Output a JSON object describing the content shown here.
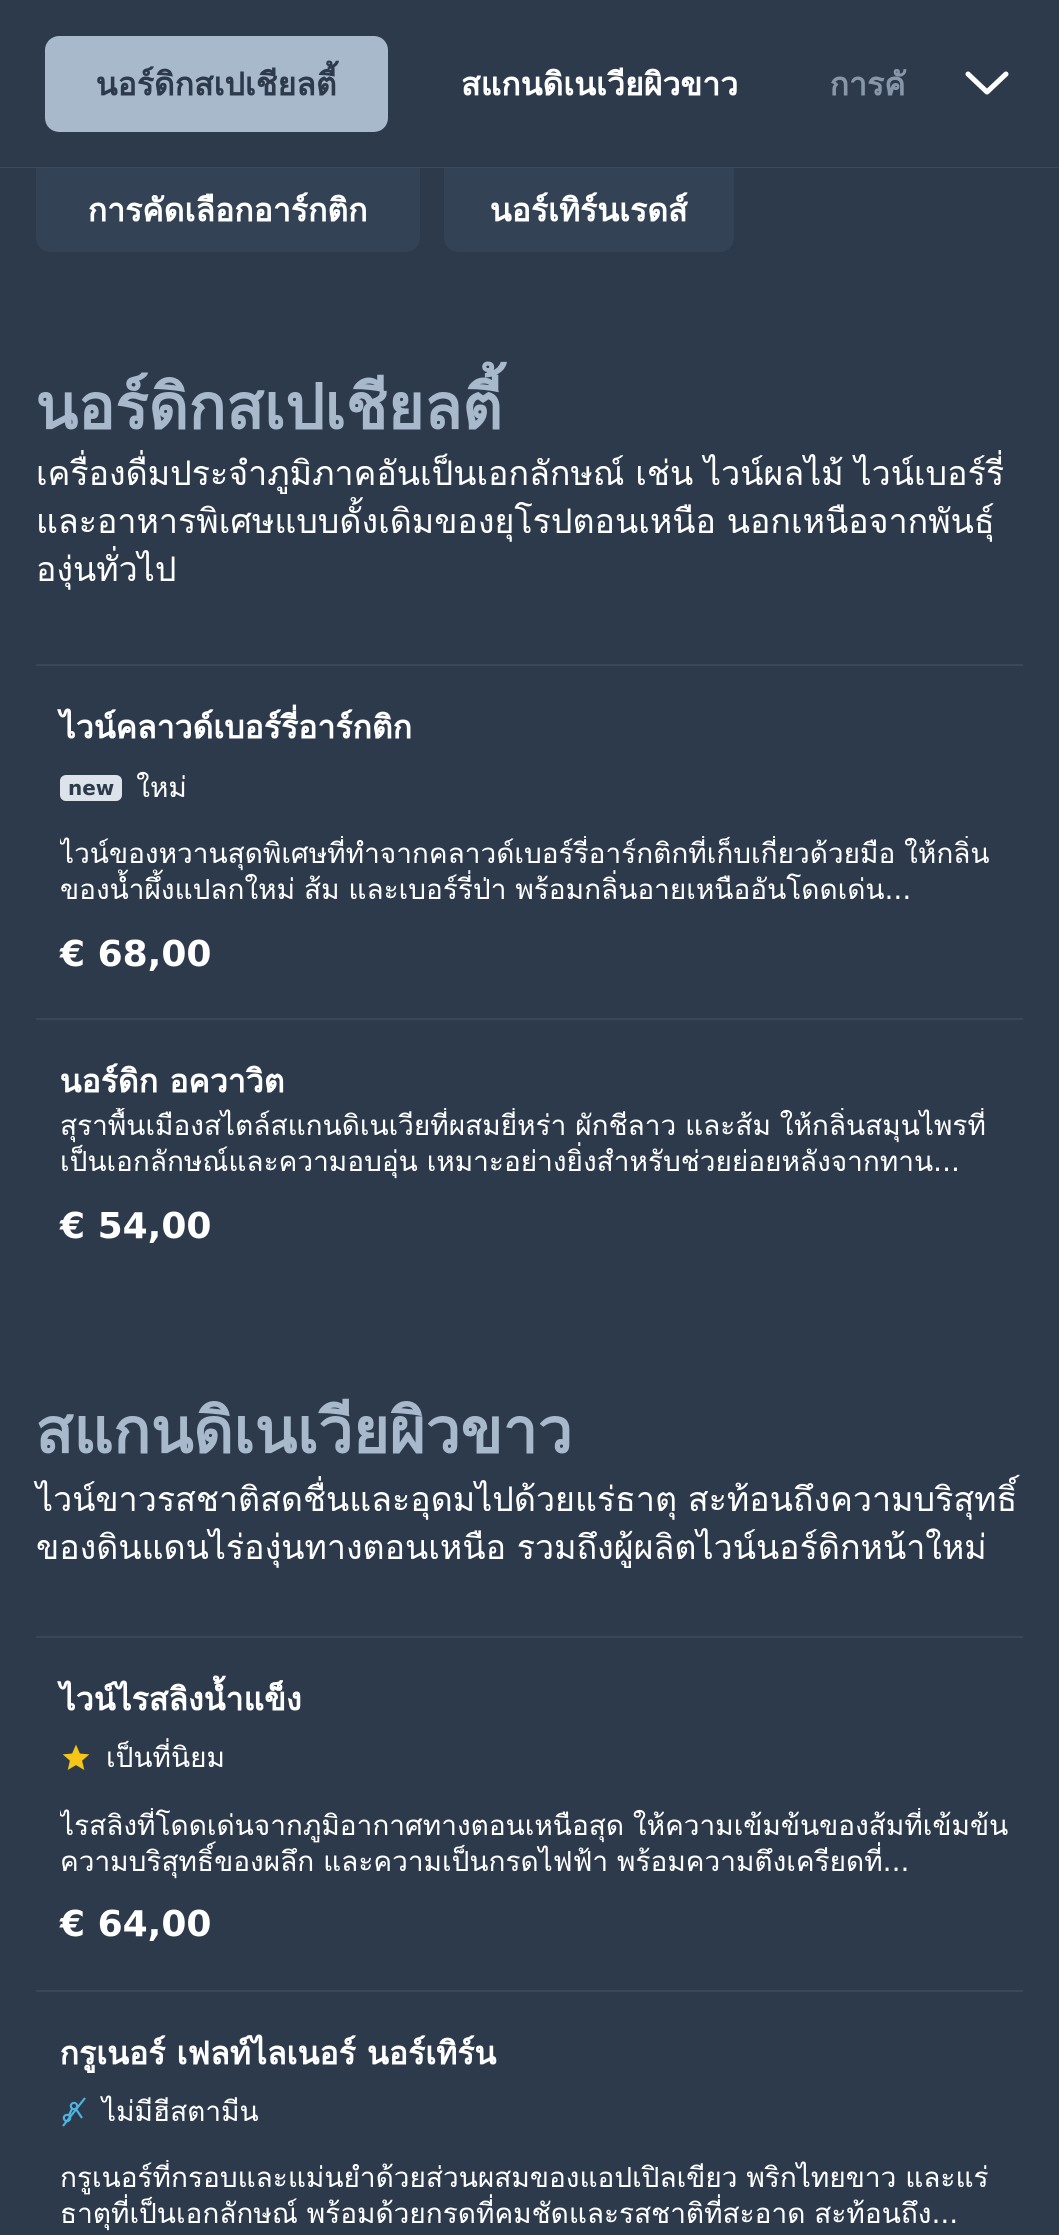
{
  "nav": {
    "tabs": [
      {
        "label": "นอร์ดิกสเปเชียลตี้"
      },
      {
        "label": "สแกนดิเนเวียผิวขาว"
      },
      {
        "label": "การคั"
      }
    ],
    "chips": [
      {
        "label": "การคัดเลือกอาร์กติก"
      },
      {
        "label": "นอร์เทิร์นเรดส์"
      }
    ],
    "expand_icon": "chevron-down-icon"
  },
  "sections": [
    {
      "title": "นอร์ดิกสเปเชียลตี้",
      "description": "เครื่องดื่มประจำภูมิภาคอันเป็นเอกลักษณ์ เช่น ไวน์ผลไม้ ไวน์เบอร์รี่ และอาหารพิเศษแบบดั้งเดิมของยุโรปตอนเหนือ นอกเหนือจากพันธุ์องุ่นทั่วไป",
      "items": [
        {
          "name": "ไวน์คลาวด์เบอร์รี่อาร์กติก",
          "badge_pill": "new",
          "badge_label": "ใหม่",
          "description": "ไวน์ของหวานสุดพิเศษที่ทำจากคลาวด์เบอร์รี่อาร์กติกที่เก็บเกี่ยวด้วยมือ ให้กลิ่นของน้ำผึ้งแปลกใหม่ ส้ม และเบอร์รี่ป่า พร้อมกลิ่นอายเหนืออันโดดเด่น...",
          "price": "€ 68,00"
        },
        {
          "name": "นอร์ดิก อควาวิต",
          "description": "สุราพื้นเมืองสไตล์สแกนดิเนเวียที่ผสมยี่หร่า ผักชีลาว และส้ม ให้กลิ่นสมุนไพรที่เป็นเอกลักษณ์และความอบอุ่น เหมาะอย่างยิ่งสำหรับช่วยย่อยหลังจากทาน...",
          "price": "€ 54,00"
        }
      ]
    },
    {
      "title": "สแกนดิเนเวียผิวขาว",
      "description": "ไวน์ขาวรสชาติสดชื่นและอุดมไปด้วยแร่ธาตุ สะท้อนถึงความบริสุทธิ์ของดินแดนไร่องุ่นทางตอนเหนือ รวมถึงผู้ผลิตไวน์นอร์ดิกหน้าใหม่",
      "items": [
        {
          "name": "ไวน์ไรสลิงน้ำแข็ง",
          "badge_icon": "star-icon",
          "badge_label": "เป็นที่นิยม",
          "description": "ไรสลิงที่โดดเด่นจากภูมิอากาศทางตอนเหนือสุด ให้ความเข้มข้นของส้มที่เข้มข้น ความบริสุทธิ์ของผลึก และความเป็นกรดไฟฟ้า พร้อมความตึงเครียดที่...",
          "price": "€ 64,00"
        },
        {
          "name": "กรูเนอร์ เฟลท์ไลเนอร์ นอร์เทิร์น",
          "badge_icon": "histamine-free-icon",
          "badge_label": "ไม่มีฮีสตามีน",
          "description": "กรูเนอร์ที่กรอบและแม่นยำด้วยส่วนผสมของแอปเปิลเขียว พริกไทยขาว และแร่ธาตุที่เป็นเอกลักษณ์ พร้อมด้วยกรดที่คมชัดและรสชาติที่สะอาด สะท้อนถึง..."
        }
      ]
    }
  ],
  "colors": {
    "background": "#2c3a4c",
    "active_tab": "#a8b9cb",
    "section_title": "#a8b9cb",
    "star": "#f5c518",
    "histamine_icon": "#4fb3e0"
  }
}
